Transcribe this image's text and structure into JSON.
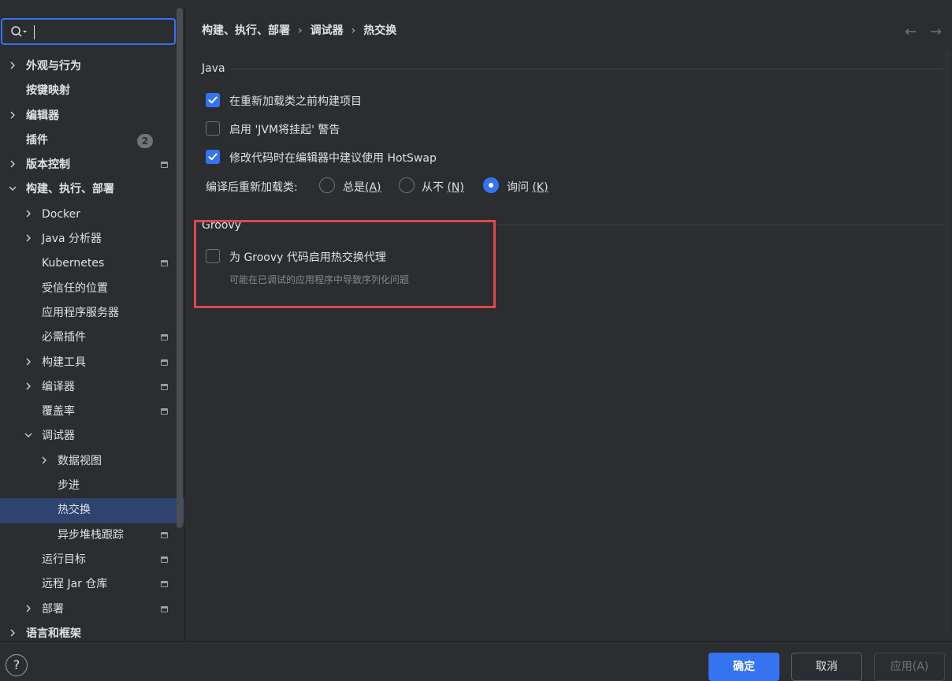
{
  "search": {
    "value": "",
    "placeholder": ""
  },
  "sidebar": {
    "items": [
      {
        "label": "外观与行为",
        "level": 0,
        "chevron": "right",
        "bold": true
      },
      {
        "label": "按键映射",
        "level": 0,
        "bold": true
      },
      {
        "label": "编辑器",
        "level": 0,
        "chevron": "right",
        "bold": true
      },
      {
        "label": "插件",
        "level": 0,
        "bold": true,
        "badge": "2"
      },
      {
        "label": "版本控制",
        "level": 0,
        "chevron": "right",
        "bold": true,
        "marker": true
      },
      {
        "label": "构建、执行、部署",
        "level": 0,
        "chevron": "down",
        "bold": true
      },
      {
        "label": "Docker",
        "level": 1,
        "chevron": "right"
      },
      {
        "label": "Java 分析器",
        "level": 1,
        "chevron": "right"
      },
      {
        "label": "Kubernetes",
        "level": 1,
        "marker": true
      },
      {
        "label": "受信任的位置",
        "level": 1
      },
      {
        "label": "应用程序服务器",
        "level": 1
      },
      {
        "label": "必需插件",
        "level": 1,
        "marker": true
      },
      {
        "label": "构建工具",
        "level": 1,
        "chevron": "right",
        "marker": true
      },
      {
        "label": "编译器",
        "level": 1,
        "chevron": "right",
        "marker": true
      },
      {
        "label": "覆盖率",
        "level": 1,
        "marker": true
      },
      {
        "label": "调试器",
        "level": 1,
        "chevron": "down"
      },
      {
        "label": "数据视图",
        "level": 2,
        "chevron": "right"
      },
      {
        "label": "步进",
        "level": 2
      },
      {
        "label": "热交换",
        "level": 2,
        "selected": true
      },
      {
        "label": "异步堆栈跟踪",
        "level": 2,
        "marker": true
      },
      {
        "label": "运行目标",
        "level": 1,
        "marker": true
      },
      {
        "label": "远程 Jar 仓库",
        "level": 1,
        "marker": true
      },
      {
        "label": "部署",
        "level": 1,
        "chevron": "right",
        "marker": true
      },
      {
        "label": "语言和框架",
        "level": 0,
        "chevron": "right",
        "bold": true
      }
    ]
  },
  "breadcrumb": {
    "part1": "构建、执行、部署",
    "part2": "调试器",
    "part3": "热交换",
    "sep": "›"
  },
  "nav": {
    "back": "←",
    "forward": "→"
  },
  "java_group": {
    "title": "Java",
    "options": [
      {
        "label": "在重新加载类之前构建项目",
        "checked": true
      },
      {
        "label": "启用 'JVM将挂起' 警告",
        "checked": false
      },
      {
        "label": "修改代码时在编辑器中建议使用 HotSwap",
        "checked": true
      }
    ],
    "reload_label": "编译后重新加载类:",
    "radio": [
      {
        "label": "总是",
        "mnemonic": "(A)",
        "selected": false
      },
      {
        "label": "从不",
        "mnemonic": "(N)",
        "selected": false
      },
      {
        "label": "询问",
        "mnemonic": "(K)",
        "selected": true
      }
    ]
  },
  "groovy_group": {
    "title": "Groovy",
    "option_label": "为 Groovy 代码启用热交换代理",
    "checked": false,
    "hint": "可能在已调试的应用程序中导致序列化问题"
  },
  "footer": {
    "help": "?",
    "ok": "确定",
    "cancel": "取消",
    "apply": "应用(A)"
  },
  "colors": {
    "accent": "#3574f0",
    "highlight_border": "#e0474b",
    "background": "#2b2d30",
    "selection": "#2e436e"
  }
}
